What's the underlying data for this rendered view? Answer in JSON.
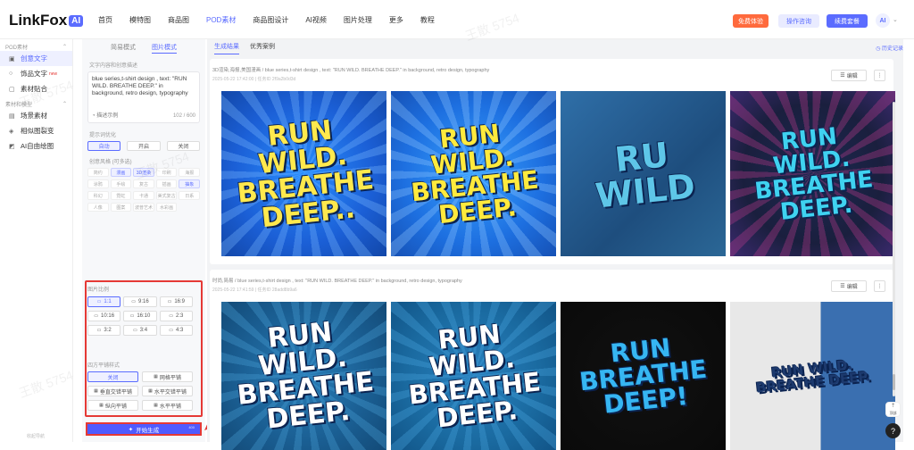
{
  "header": {
    "logo": "LinkFox",
    "logo_badge": "AI",
    "nav": [
      "首页",
      "模特图",
      "商品图",
      "POD素材",
      "商品图设计",
      "AI视频",
      "图片处理",
      "更多",
      "教程"
    ],
    "nav_active": 3,
    "pay_btn": "免费体验",
    "guide_btn": "操作咨询",
    "upgrade_btn": "续费套餐"
  },
  "sidebar": {
    "section1": "POD素材",
    "items1": [
      "创意文字",
      "饰品文字",
      "素材贴合"
    ],
    "section2": "素材和模型",
    "items2": [
      "场景素材",
      "相似图裂变",
      "AI自由绘图"
    ],
    "footer": "收起导航"
  },
  "panel": {
    "tabs": [
      "简易模式",
      "图片模式"
    ],
    "prompt_label": "文字内容和创意描述",
    "prompt_text": "blue series,t-shirt design , text: \"RUN WILD. BREATHE DEEP.\" in background, retro design, typography",
    "prompt_option": "描述示例",
    "counter": "102 / 600",
    "enhance_label": "提示词优化",
    "enhance_opts": [
      "自动",
      "开启",
      "关闭"
    ],
    "style_label": "创意风格 (可多选)",
    "style_tags": [
      "简约",
      "漫画",
      "3D渲染",
      "印刷",
      "海报",
      "涂鸦",
      "手绘",
      "复古",
      "插画",
      "抽象",
      "科幻",
      "霓虹",
      "卡通",
      "美式复古",
      "日系",
      "人像",
      "图案",
      "波普艺术",
      "水彩画"
    ],
    "ratio_label": "图片比例",
    "ratios": [
      "1:1",
      "9:16",
      "16:9",
      "10:16",
      "16:10",
      "2:3",
      "3:2",
      "3:4",
      "4:3"
    ],
    "tile_label": "四方平铺样式",
    "tiles": [
      "关闭",
      "网格平铺",
      "垂直交错平铺",
      "水平交错平铺",
      "纵向平铺",
      "水平平铺"
    ],
    "generate": "开始生成",
    "generate_cost": "400"
  },
  "main": {
    "tabs": [
      "生成结果",
      "优秀案例"
    ],
    "history_link": "历史记录",
    "cards": [
      {
        "tags": "3D渲染,海报,美国漫画",
        "prompt": "blue series,t-shirt design , text: \"RUN WILD. BREATHE DEEP.\" in background, retro design, typography",
        "time": "2025-05-22 17:42:00 | 任务ID 2f9a2b0d3d",
        "edit": "编辑",
        "images": [
          "RUN\nWILD.\nBREATHE\nDEEP..",
          "RUN\nWILD.\nBREATHE\nDEEP.",
          "RU\nWILD",
          "RUN\nWILD.\nBREATHE\nDEEP."
        ]
      },
      {
        "tags": "时尚,简易",
        "prompt": "blue series,t-shirt design , text: \"RUN WILD. BREATHE DEEP.\" in background, retro design, typography",
        "time": "2025-05-22 17:41:59 | 任务ID 28add8b9a6",
        "edit": "编辑",
        "images": [
          "RUN\nWILD.\nBREATHE\nDEEP.",
          "RUN\nWILD.\nBREATHE\nDEEP.",
          "RUN\nBREATHE\nDEEP!",
          "RUN WILD.\nBREATHE DEEP."
        ]
      }
    ]
  },
  "float": {
    "help": "?",
    "top": "顶部"
  },
  "watermark": "王散 5754"
}
